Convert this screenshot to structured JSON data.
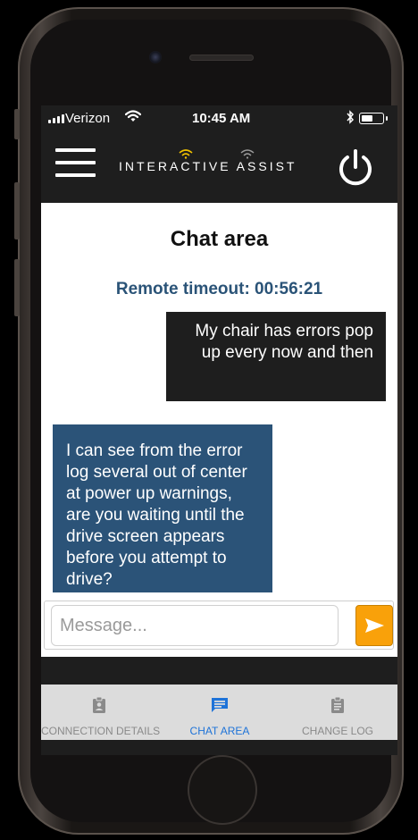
{
  "status_bar": {
    "carrier": "Verizon",
    "time": "10:45 AM"
  },
  "header": {
    "brand": "INTERACTIVE ASSIST"
  },
  "chat": {
    "title": "Chat area",
    "timeout": "Remote timeout: 00:56:21",
    "messages": [
      {
        "sender": "user",
        "text": "My chair has errors pop up every now and then"
      },
      {
        "sender": "remote",
        "text": "I can see from the error log several out of center at power up warnings, are you waiting until the drive screen appears before you attempt to drive?"
      }
    ],
    "input_placeholder": "Message..."
  },
  "tabs": [
    {
      "label": "CONNECTION DETAILS",
      "icon": "clipboard-person-icon",
      "active": false
    },
    {
      "label": "CHAT AREA",
      "icon": "chat-bubble-icon",
      "active": true
    },
    {
      "label": "CHANGE LOG",
      "icon": "clipboard-list-icon",
      "active": false
    }
  ],
  "colors": {
    "accent": "#f9a10a",
    "remote_bubble": "#2b5378",
    "user_bubble": "#1e1e1e",
    "active_tab": "#1e73d8",
    "timeout_text": "#2a5377"
  }
}
